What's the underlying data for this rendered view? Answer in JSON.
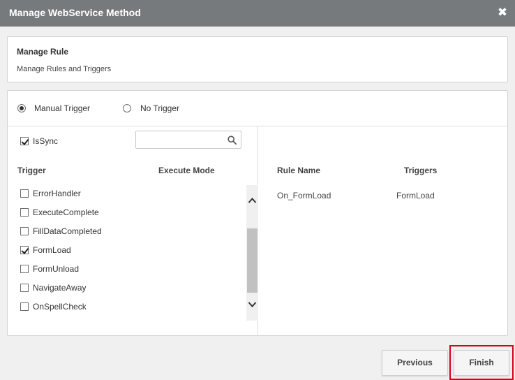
{
  "dialog": {
    "title": "Manage WebService Method",
    "close_symbol": "✖"
  },
  "header": {
    "title": "Manage Rule",
    "subtitle": "Manage Rules and Triggers"
  },
  "trigger_mode": {
    "options": [
      {
        "label": "Manual Trigger",
        "selected": true
      },
      {
        "label": "No Trigger",
        "selected": false
      }
    ]
  },
  "left": {
    "issync": {
      "label": "IsSync",
      "checked": true
    },
    "search": {
      "value": "",
      "placeholder": ""
    },
    "columns": {
      "trigger": "Trigger",
      "execute_mode": "Execute Mode"
    },
    "items": [
      {
        "label": "ErrorHandler",
        "checked": false
      },
      {
        "label": "ExecuteComplete",
        "checked": false
      },
      {
        "label": "FillDataCompleted",
        "checked": false
      },
      {
        "label": "FormLoad",
        "checked": true
      },
      {
        "label": "FormUnload",
        "checked": false
      },
      {
        "label": "NavigateAway",
        "checked": false
      },
      {
        "label": "OnSpellCheck",
        "checked": false
      }
    ]
  },
  "right": {
    "columns": {
      "rule_name": "Rule Name",
      "triggers": "Triggers"
    },
    "rows": [
      {
        "rule_name": "On_FormLoad",
        "triggers": "FormLoad"
      }
    ]
  },
  "footer": {
    "previous_label": "Previous",
    "finish_label": "Finish",
    "highlight_color": "#d9001b"
  }
}
